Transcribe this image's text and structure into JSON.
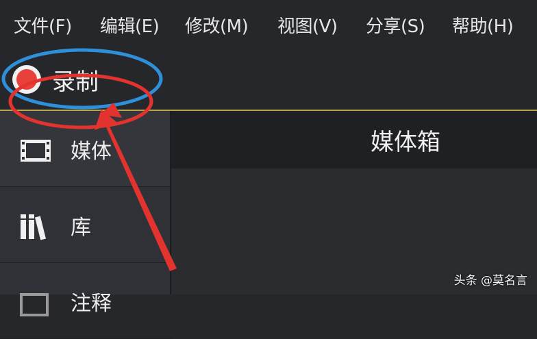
{
  "menu": {
    "items": [
      {
        "label": "文件(F)"
      },
      {
        "label": "编辑(E)"
      },
      {
        "label": "修改(M)"
      },
      {
        "label": "视图(V)"
      },
      {
        "label": "分享(S)"
      },
      {
        "label": "帮助(H)"
      }
    ]
  },
  "toolbar": {
    "record_label": "录制"
  },
  "sidebar": {
    "items": [
      {
        "label": "媒体",
        "icon": "film-icon",
        "active": true
      },
      {
        "label": "库",
        "icon": "library-books-icon",
        "active": false
      },
      {
        "label": "注释",
        "icon": "annotation-icon",
        "active": false
      }
    ]
  },
  "panel": {
    "title": "媒体箱"
  },
  "watermark": {
    "text": "头条 @莫名言"
  },
  "colors": {
    "background": "#25272b",
    "sidebar": "#2f3136",
    "accent_line": "#b9a64a",
    "record_red": "#e8403a",
    "annotation_blue": "#2f8fd8",
    "annotation_red": "#e2332f"
  }
}
